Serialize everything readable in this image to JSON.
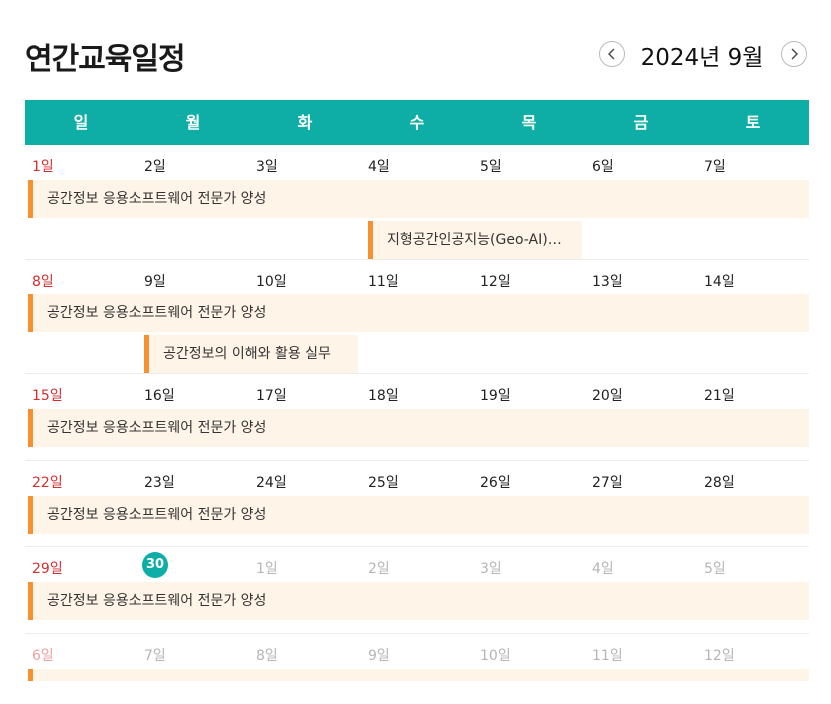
{
  "title": "연간교육일정",
  "month_label": "2024년 9월",
  "weekdays": [
    "일",
    "월",
    "화",
    "수",
    "목",
    "금",
    "토"
  ],
  "colors": {
    "accent": "#0eaea6",
    "event_bar": "#f7912f",
    "event_bg": "#fff4e8",
    "sunday": "#d32f2f"
  },
  "weeks": [
    {
      "dates": [
        "1일",
        "2일",
        "3일",
        "4일",
        "5일",
        "6일",
        "7일"
      ],
      "events": [
        {
          "label": "공간정보 응용소프트웨어 전문가 양성"
        },
        {
          "label": "지형공간인공지능(Geo-AI)…"
        }
      ]
    },
    {
      "dates": [
        "8일",
        "9일",
        "10일",
        "11일",
        "12일",
        "13일",
        "14일"
      ],
      "events": [
        {
          "label": "공간정보 응용소프트웨어 전문가 양성"
        },
        {
          "label": "공간정보의 이해와 활용 실무"
        }
      ]
    },
    {
      "dates": [
        "15일",
        "16일",
        "17일",
        "18일",
        "19일",
        "20일",
        "21일"
      ],
      "events": [
        {
          "label": "공간정보 응용소프트웨어 전문가 양성"
        }
      ]
    },
    {
      "dates": [
        "22일",
        "23일",
        "24일",
        "25일",
        "26일",
        "27일",
        "28일"
      ],
      "events": [
        {
          "label": "공간정보 응용소프트웨어 전문가 양성"
        }
      ]
    },
    {
      "dates": [
        "29일",
        "30일",
        "1일",
        "2일",
        "3일",
        "4일",
        "5일"
      ],
      "events": [
        {
          "label": "공간정보 응용소프트웨어 전문가 양성"
        }
      ]
    },
    {
      "dates": [
        "6일",
        "7일",
        "8일",
        "9일",
        "10일",
        "11일",
        "12일"
      ],
      "events": []
    }
  ]
}
